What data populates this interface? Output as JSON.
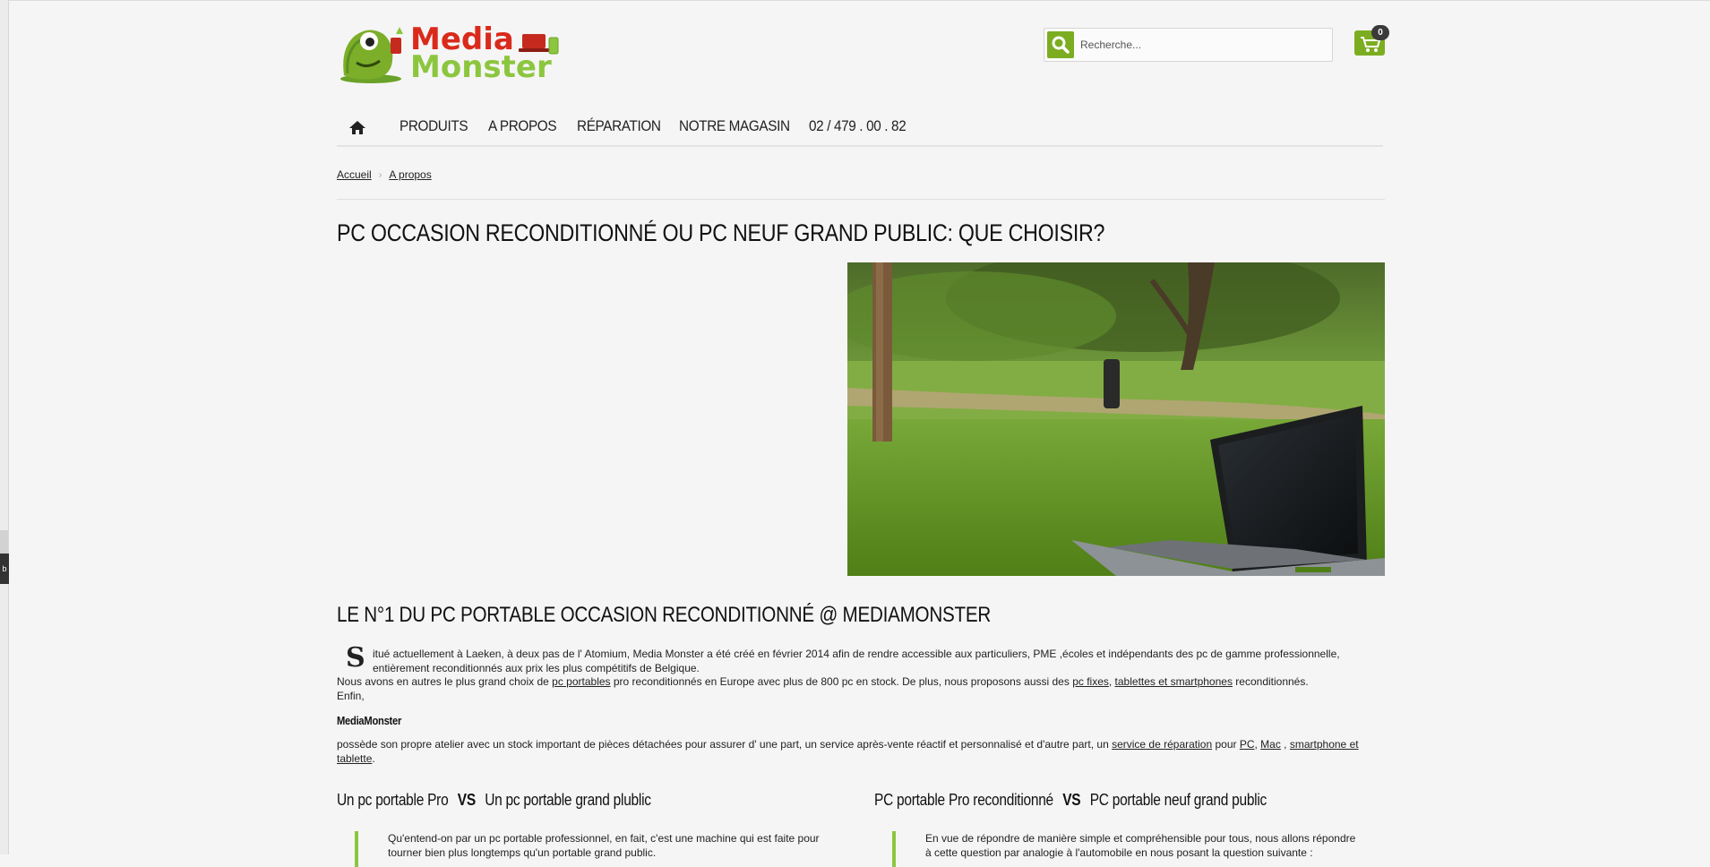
{
  "header": {
    "logo_line1": "Media",
    "logo_line2": "Monster",
    "search_placeholder": "Recherche...",
    "cart_count": "0"
  },
  "nav": {
    "items": [
      "PRODUITS",
      "A PROPOS",
      "RÉPARATION",
      "NOTRE MAGASIN",
      "02 / 479 . 00 . 82"
    ]
  },
  "breadcrumb": {
    "home": "Accueil",
    "sep": "›",
    "current": "A propos"
  },
  "page": {
    "title": "PC OCCASION RECONDITIONNÉ OU PC NEUF GRAND PUBLIC: QUE CHOISIR?",
    "subtitle": "LE N°1 DU PC PORTABLE OCCASION RECONDITIONNÉ @ MEDIAMONSTER",
    "dropcap": "S",
    "p1": "itué actuellement à Laeken, à deux pas de l' Atomium, Media Monster a été créé en février 2014 afin de rendre accessible aux particuliers, PME ,écoles et indépendants des pc de gamme professionnelle, entièrement reconditionnés aux prix les plus compétitifs de Belgique.",
    "p2_a": "Nous avons en autres le plus grand choix de ",
    "p2_link1": "pc portables",
    "p2_b": " pro reconditionnés en Europe avec plus de 800 pc en stock. De plus, nous proposons aussi des ",
    "p2_link2": "pc fixes",
    "p2_c": ", ",
    "p2_link3": "tablettes et smartphones",
    "p2_d": " reconditionnés.",
    "p3": "Enfin,",
    "brand": "MediaMonster",
    "p4_a": "possède son propre atelier avec un stock important de pièces détachées pour assurer d' une part, un service après-vente réactif et personnalisé et d'autre part, un ",
    "p4_link1": "service de réparation",
    "p4_b": " pour ",
    "p4_link2": "PC",
    "p4_c": ", ",
    "p4_link3": "Mac",
    "p4_d": " , ",
    "p4_link4": "smartphone et tablette",
    "p4_e": "."
  },
  "columns": [
    {
      "left": "Un pc portable Pro",
      "vs": "VS",
      "right": "Un pc portable grand plublic",
      "quote": "Qu'entend-on par un pc portable professionnel, en fait, c'est une machine qui est faite pour tourner bien plus longtemps qu'un portable grand public."
    },
    {
      "left": "PC portable Pro reconditionné",
      "vs": "VS",
      "right": "PC portable neuf grand public",
      "quote": "En vue de répondre de manière simple et compréhensible pour tous, nous allons répondre à cette question par analogie à l'automobile en nous posant la question suivante :"
    }
  ],
  "colors": {
    "accent_green": "#8cc63f",
    "button_green": "#7cad21",
    "logo_red": "#d92a1c"
  },
  "icons": [
    "home-icon",
    "search-icon",
    "cart-icon"
  ]
}
